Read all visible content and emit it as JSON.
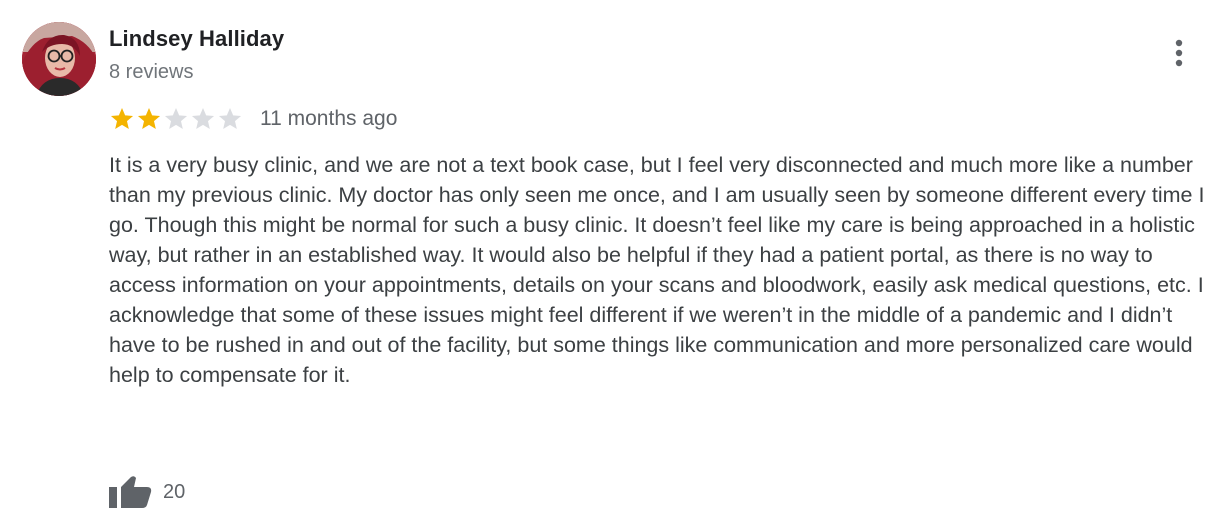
{
  "review": {
    "author_name": "Lindsey Halliday",
    "review_count": "8 reviews",
    "rating": 2,
    "rating_max": 5,
    "date": "11 months ago",
    "text": "It is a very busy clinic, and we are not a text book case, but I feel very disconnected and much more like a number than my previous clinic. My doctor has only seen me once, and I am usually seen by someone different every time I go. Though this might be normal for such a busy clinic. It doesn’t feel like my care is being approached in a holistic way, but rather in an established way. It would also be helpful if they had a patient portal, as there is no way to access information on your appointments, details on your scans and bloodwork, easily ask medical questions, etc. I acknowledge that some of these issues might feel different if we weren’t in the middle of a pandemic and I didn’t have to be rushed in and out of the facility, but some things like communication and more personalized care would help to compensate for it.",
    "like_count": "20"
  },
  "icons": {
    "avatar": "user-avatar-photo",
    "more": "more-vert-icon",
    "star_filled": "star-filled-icon",
    "star_empty": "star-empty-icon",
    "like": "thumbs-up-icon"
  },
  "colors": {
    "star_filled": "#f4b400",
    "star_empty": "#dadce0",
    "like_icon": "#5f6368"
  }
}
